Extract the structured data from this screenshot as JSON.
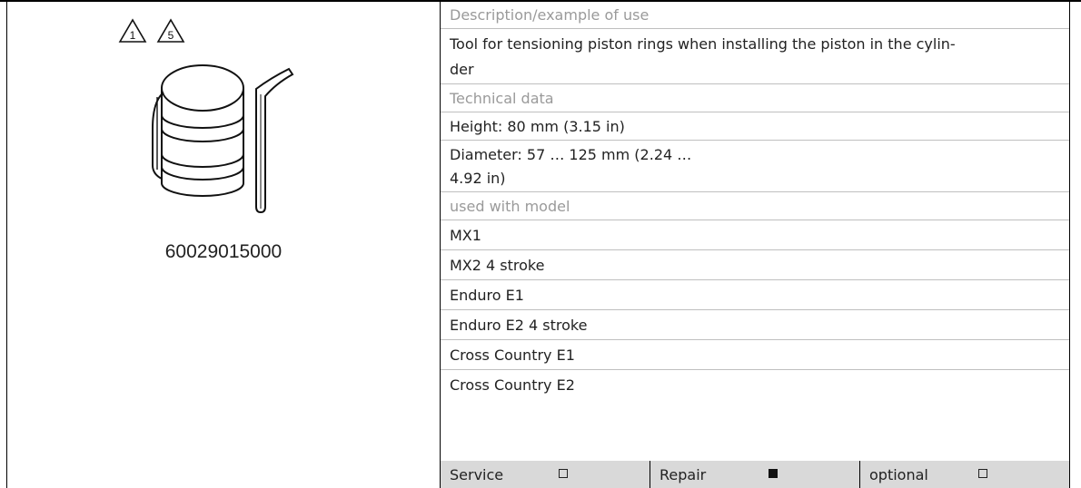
{
  "tool": {
    "part_number": "60029015000",
    "warning_badges": [
      "1",
      "5"
    ],
    "image_icon": "piston-ring-compressor-icon"
  },
  "details": {
    "description_label": "Description/example of use",
    "description_line1": "Tool for tensioning piston rings when installing the piston in the cylin-",
    "description_line2": "der",
    "technical_label": "Technical data",
    "height": "Height: 80 mm (3.15 in)",
    "diameter_line1": "Diameter: 57 … 125 mm (2.24 …",
    "diameter_line2": "4.92 in)",
    "models_label": "used with model",
    "models": [
      "MX1",
      "MX2 4 stroke",
      "Enduro E1",
      "Enduro E2 4 stroke",
      "Cross Country E1",
      "Cross Country E2"
    ]
  },
  "footer": {
    "items": [
      {
        "label": "Service",
        "checked": false
      },
      {
        "label": "Repair",
        "checked": true
      },
      {
        "label": "optional",
        "checked": false
      }
    ]
  }
}
